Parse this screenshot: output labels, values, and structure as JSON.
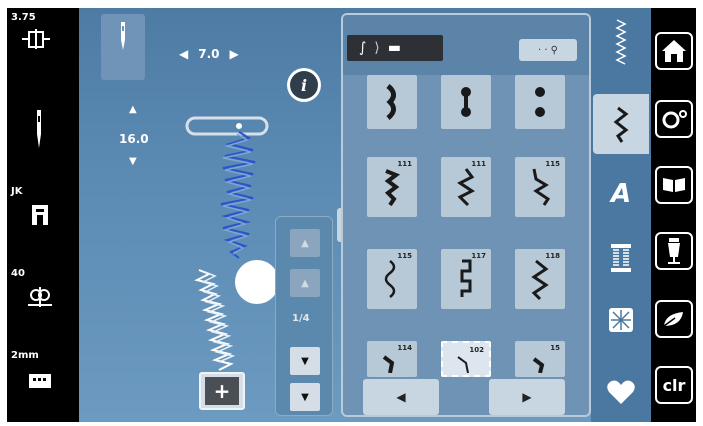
{
  "status": {
    "top_value": "3.75",
    "presser_value": "JK",
    "tension_value": "40",
    "stitch_plate_value": "2mm"
  },
  "stitch_settings": {
    "width_value": "7.0",
    "length_value": "16.0"
  },
  "scroll": {
    "page_indicator": "1/4"
  },
  "stitch_tiles": {
    "row2": [
      "111",
      "111",
      "115"
    ],
    "row3": [
      "115",
      "117",
      "118"
    ],
    "row4": [
      "114",
      "102",
      "15"
    ]
  },
  "right_nav": {
    "clear_label": "clr"
  },
  "colors": {
    "main_bg": "#5b8ab3",
    "panel_bg": "#6f93b5",
    "tile_bg": "#b7c8d6",
    "stitch_color": "#1a1a1a",
    "preview_blue": "#2a56c8"
  },
  "icons": {
    "left": [
      "needle-position-icon",
      "needle-icon",
      "presser-foot-icon",
      "tension-icon",
      "stitch-plate-icon"
    ],
    "right": [
      "home-icon",
      "settings-icon",
      "tutorial-book-icon",
      "sewing-consultant-icon",
      "eco-icon"
    ],
    "tabs": [
      "zigzag-category-icon",
      "practical-stitch-icon",
      "alphabet-icon",
      "buttonhole-icon",
      "quilt-icon",
      "heart-icon"
    ]
  }
}
